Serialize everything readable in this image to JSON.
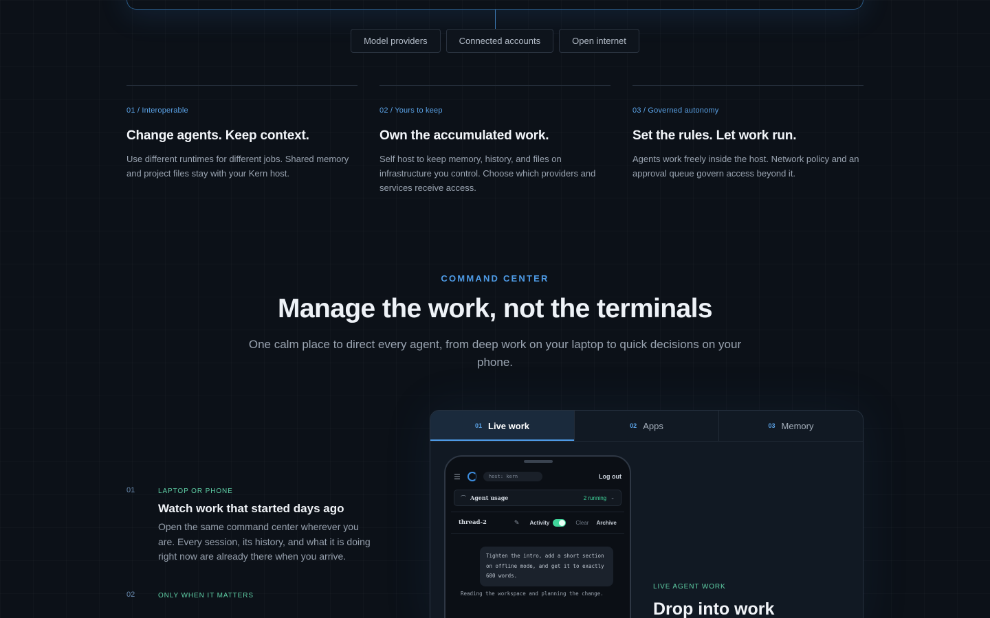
{
  "providers": [
    "Model providers",
    "Connected accounts",
    "Open internet"
  ],
  "pillars": [
    {
      "kicker": "01 / Interoperable",
      "title": "Change agents. Keep context.",
      "text": "Use different runtimes for different jobs. Shared memory and project files stay with your Kern host."
    },
    {
      "kicker": "02 / Yours to keep",
      "title": "Own the accumulated work.",
      "text": "Self host to keep memory, history, and files on infrastructure you control. Choose which providers and services receive access."
    },
    {
      "kicker": "03 / Governed autonomy",
      "title": "Set the rules. Let work run.",
      "text": "Agents work freely inside the host. Network policy and an approval queue govern access beyond it."
    }
  ],
  "command_center": {
    "kicker": "COMMAND CENTER",
    "title": "Manage the work, not the terminals",
    "subtitle": "One calm place to direct every agent, from deep work on your laptop to quick decisions on your phone."
  },
  "features": [
    {
      "num": "01",
      "kicker": "LAPTOP OR PHONE",
      "title": "Watch work that started days ago",
      "text": "Open the same command center wherever you are. Every session, its history, and what it is doing right now are already there when you arrive."
    },
    {
      "num": "02",
      "kicker": "ONLY WHEN IT MATTERS",
      "title": "",
      "text": ""
    }
  ],
  "tabs": [
    {
      "num": "01",
      "label": "Live work",
      "active": true
    },
    {
      "num": "02",
      "label": "Apps",
      "active": false
    },
    {
      "num": "03",
      "label": "Memory",
      "active": false
    }
  ],
  "phone": {
    "host": "host: kern",
    "logout": "Log out",
    "usage_label": "Agent usage",
    "running": "2 running",
    "thread": "thread-2",
    "activity": "Activity",
    "clear": "Clear",
    "archive": "Archive",
    "message": "Tighten the intro, add a short section on offline mode, and get it to exactly 600 words.",
    "status": "Reading the workspace and planning the change."
  },
  "live": {
    "kicker": "LIVE AGENT WORK",
    "title": "Drop into work"
  },
  "colors": {
    "accent": "#4e9be6",
    "green": "#3fd49a",
    "bg": "#0c1118"
  }
}
